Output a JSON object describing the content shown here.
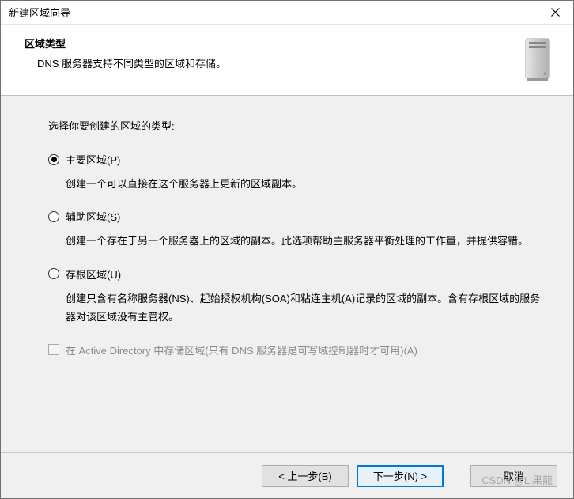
{
  "window": {
    "title": "新建区域向导"
  },
  "header": {
    "title": "区域类型",
    "subtitle": "DNS 服务器支持不同类型的区域和存储。"
  },
  "body": {
    "instruction": "选择你要创建的区域的类型:",
    "options": [
      {
        "label": "主要区域(P)",
        "description": "创建一个可以直接在这个服务器上更新的区域副本。",
        "checked": true
      },
      {
        "label": "辅助区域(S)",
        "description": "创建一个存在于另一个服务器上的区域的副本。此选项帮助主服务器平衡处理的工作量，并提供容错。",
        "checked": false
      },
      {
        "label": "存根区域(U)",
        "description": "创建只含有名称服务器(NS)、起始授权机构(SOA)和粘连主机(A)记录的区域的副本。含有存根区域的服务器对该区域没有主管权。",
        "checked": false
      }
    ],
    "checkbox": {
      "label": "在 Active Directory 中存储区域(只有 DNS 服务器是可写域控制器时才可用)(A)",
      "enabled": false,
      "checked": false
    }
  },
  "footer": {
    "back": "< 上一步(B)",
    "next": "下一步(N) >",
    "cancel": "取消"
  },
  "watermark": "CSDN @Li果龍"
}
